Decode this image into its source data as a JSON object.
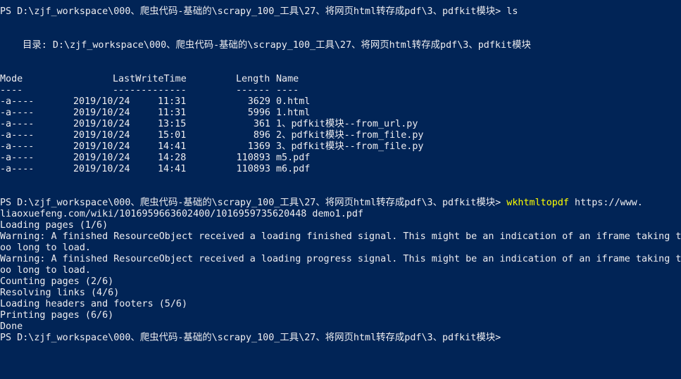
{
  "prompt1": "PS D:\\zjf_workspace\\000、爬虫代码-基础的\\scrapy_100_工具\\27、将网页html转存成pdf\\3、pdfkit模块>",
  "command1": "ls",
  "directory_label": "目录: D:\\zjf_workspace\\000、爬虫代码-基础的\\scrapy_100_工具\\27、将网页html转存成pdf\\3、pdfkit模块",
  "table": {
    "headers": {
      "mode": "Mode",
      "lastwritetime": "LastWriteTime",
      "length": "Length",
      "name": "Name"
    },
    "underlines": {
      "mode": "----",
      "lastwritetime": "-------------",
      "length": "------",
      "name": "----"
    },
    "rows": [
      {
        "mode": "-a----",
        "date": "2019/10/24",
        "time": "11:31",
        "length": "3629",
        "name": "0.html"
      },
      {
        "mode": "-a----",
        "date": "2019/10/24",
        "time": "11:31",
        "length": "5996",
        "name": "1.html"
      },
      {
        "mode": "-a----",
        "date": "2019/10/24",
        "time": "13:15",
        "length": "361",
        "name": "1、pdfkit模块--from_url.py"
      },
      {
        "mode": "-a----",
        "date": "2019/10/24",
        "time": "15:01",
        "length": "896",
        "name": "2、pdfkit模块--from_file.py"
      },
      {
        "mode": "-a----",
        "date": "2019/10/24",
        "time": "14:41",
        "length": "1369",
        "name": "3、pdfkit模块--from_file.py"
      },
      {
        "mode": "-a----",
        "date": "2019/10/24",
        "time": "14:28",
        "length": "110893",
        "name": "m5.pdf"
      },
      {
        "mode": "-a----",
        "date": "2019/10/24",
        "time": "14:41",
        "length": "110893",
        "name": "m6.pdf"
      }
    ]
  },
  "prompt2": "PS D:\\zjf_workspace\\000、爬虫代码-基础的\\scrapy_100_工具\\27、将网页html转存成pdf\\3、pdfkit模块>",
  "command2_name": "wkhtmltopdf",
  "command2_args_line1": "https://www.",
  "command2_args_line2": "liaoxuefeng.com/wiki/1016959663602400/1016959735620448 demo1.pdf",
  "output": [
    "Loading pages (1/6)",
    "Warning: A finished ResourceObject received a loading finished signal. This might be an indication of an iframe taking t",
    "oo long to load.",
    "Warning: A finished ResourceObject received a loading progress signal. This might be an indication of an iframe taking t",
    "oo long to load.",
    "Counting pages (2/6)",
    "Resolving links (4/6)",
    "Loading headers and footers (5/6)",
    "Printing pages (6/6)",
    "Done"
  ],
  "prompt3": "PS D:\\zjf_workspace\\000、爬虫代码-基础的\\scrapy_100_工具\\27、将网页html转存成pdf\\3、pdfkit模块>",
  "colors": {
    "background": "#012456",
    "text": "#eeedf0",
    "command": "#ffff00"
  }
}
